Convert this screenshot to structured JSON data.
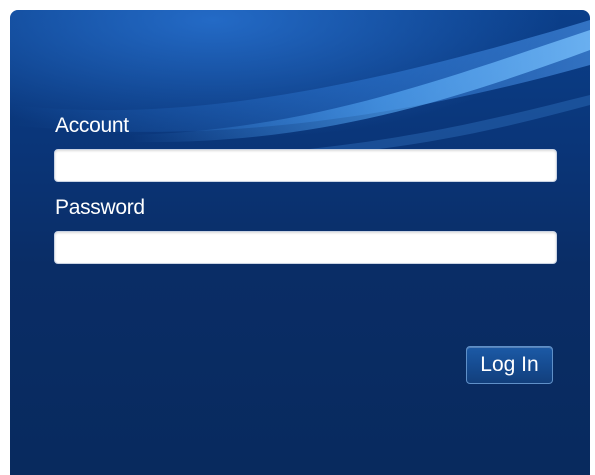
{
  "login": {
    "account_label": "Account",
    "account_value": "",
    "password_label": "Password",
    "password_value": "",
    "login_button_label": "Log In"
  },
  "colors": {
    "panel_background": "#0a2d66",
    "highlight": "#3b8ae0",
    "label_text": "#ffffff",
    "input_background": "#ffffff"
  }
}
